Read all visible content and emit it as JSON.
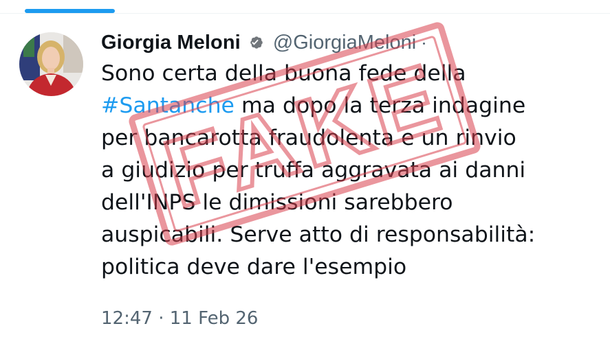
{
  "tweet": {
    "author": {
      "name": "Giorgia Meloni",
      "handle": "@GiorgiaMeloni",
      "verified_icon": "verified-badge-icon"
    },
    "text_lines": [
      "Sono certa della buona fede della",
      {
        "hashtag": "#Santanche",
        "rest": " ma dopo la terza indagine"
      },
      "per bancarotta fraudolenta e un rinvio",
      "a giudizio per truffa aggravata ai danni",
      "dell'INPS le dimissioni sarebbero",
      "auspicabili. Serve atto di responsabilità:",
      "politica deve dare l'esempio"
    ],
    "timestamp": "12:47 · 11 Feb 26"
  },
  "overlay": {
    "stamp_text": "FAKE",
    "stamp_color": "#d9414e"
  },
  "colors": {
    "accent": "#1d9bf0",
    "text": "#0f1419",
    "secondary": "#536471"
  }
}
